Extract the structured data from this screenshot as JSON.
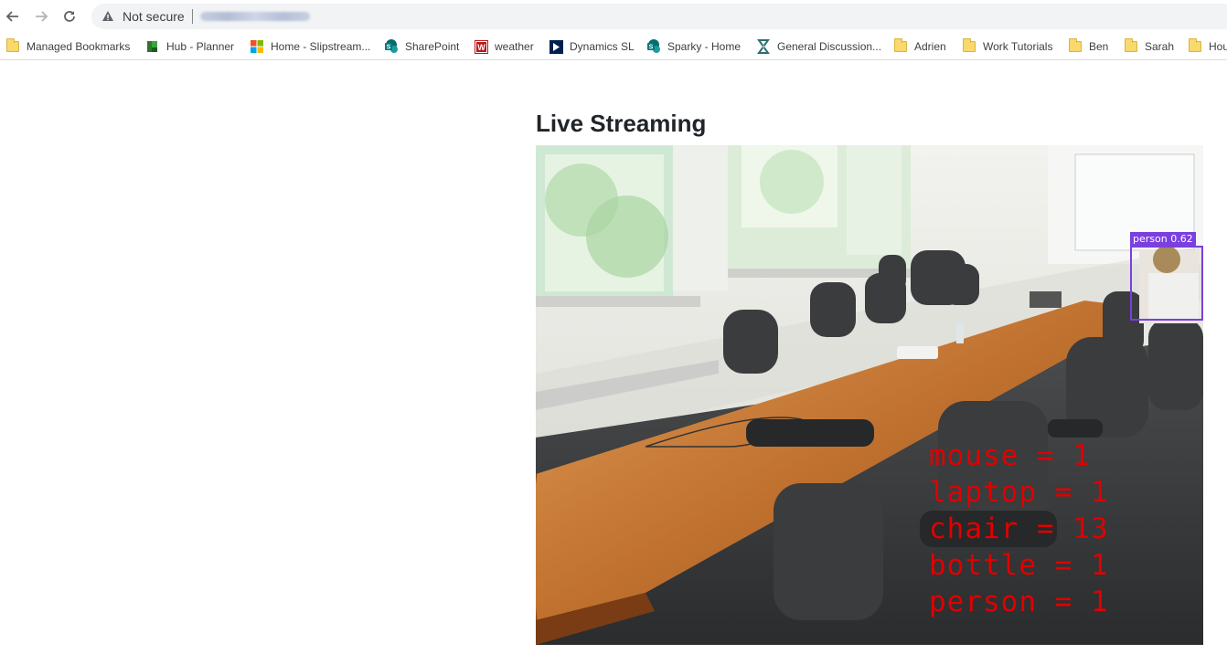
{
  "browser": {
    "security_label": "Not secure",
    "bookmarks": [
      {
        "label": "Managed Bookmarks",
        "icon": "folder-icon"
      },
      {
        "label": "Hub - Planner",
        "icon": "planner-icon"
      },
      {
        "label": "Home - Slipstream...",
        "icon": "microsoft-icon"
      },
      {
        "label": "SharePoint",
        "icon": "sharepoint-icon"
      },
      {
        "label": "weather",
        "icon": "weather-icon"
      },
      {
        "label": "Dynamics SL",
        "icon": "dynamics-icon"
      },
      {
        "label": "Sparky - Home",
        "icon": "sharepoint-icon"
      },
      {
        "label": "General Discussion...",
        "icon": "discussion-icon"
      },
      {
        "label": "Adrien",
        "icon": "folder-icon"
      },
      {
        "label": "Work Tutorials",
        "icon": "folder-icon"
      },
      {
        "label": "Ben",
        "icon": "folder-icon"
      },
      {
        "label": "Sarah",
        "icon": "folder-icon"
      },
      {
        "label": "Hou",
        "icon": "folder-icon"
      }
    ]
  },
  "page": {
    "title": "Live Streaming"
  },
  "stream": {
    "detection": {
      "label": "person 0.62",
      "color": "#7b3fe0"
    },
    "counts": [
      "mouse = 1",
      "laptop = 1",
      "chair = 13",
      "bottle = 1",
      "person = 1"
    ],
    "count_color": "#e00000"
  }
}
